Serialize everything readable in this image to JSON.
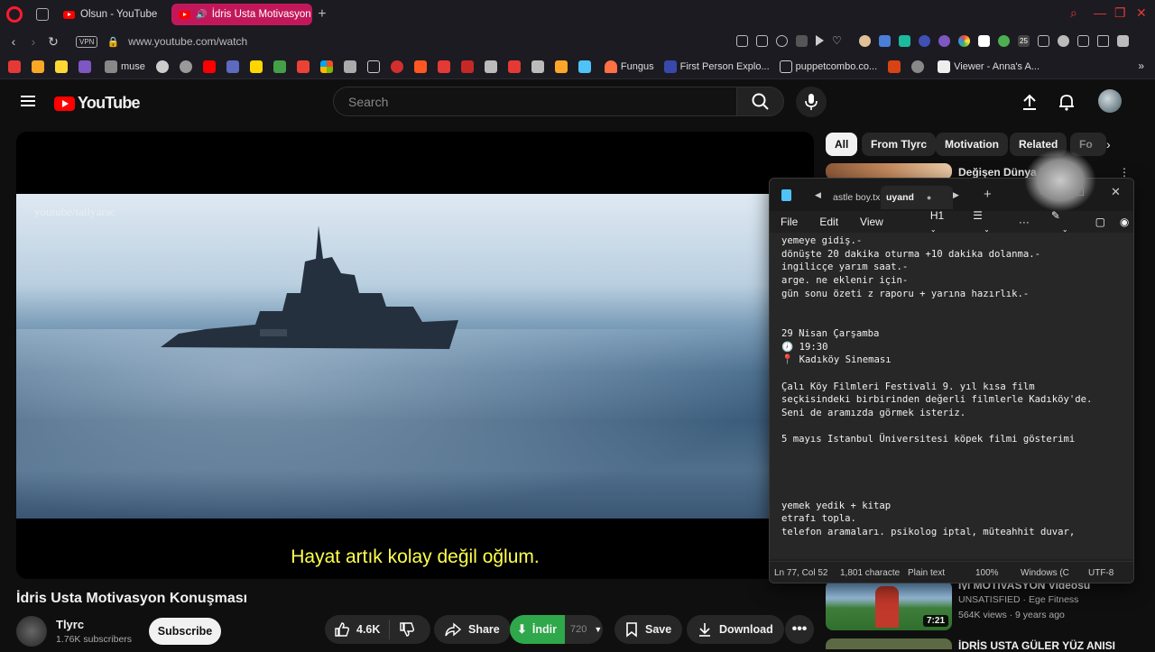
{
  "browser": {
    "tabs": [
      {
        "title": "Olsun - YouTube",
        "active": false
      },
      {
        "title": "İdris Usta Motivasyon K",
        "active": true
      }
    ],
    "url": "www.youtube.com/watch",
    "vpn_label": "VPN",
    "extension_badge": "25",
    "bookmarks": [
      "muse",
      "Fungus",
      "First Person Explo...",
      "puppetcombo.co...",
      "Viewer - Anna's A..."
    ]
  },
  "youtube": {
    "logo_text": "YouTube",
    "search_placeholder": "Search",
    "chips": [
      "All",
      "From Tlyrc",
      "Motivation",
      "Related",
      "Fo"
    ],
    "video": {
      "watermark": "youtube/tallyarac",
      "subtitle": "Hayat artık kolay değil oğlum.",
      "title": "İdris Usta Motivasyon Konuşması",
      "channel": "Tlyrc",
      "subscribers": "1.76K subscribers",
      "subscribe_label": "Subscribe",
      "likes": "4.6K",
      "share_label": "Share",
      "indir_label": "İndir",
      "quality": "720",
      "save_label": "Save",
      "download_label": "Download"
    },
    "recommendations": [
      {
        "title": "Değişen Dünya Koşulla",
        "channel": "",
        "meta": "",
        "duration": ""
      },
      {
        "title": "İyi MOTİVASYON Videosu",
        "channel": "UNSATISFIED · Ege Fitness",
        "meta": "564K views · 9 years ago",
        "duration": "7:21"
      },
      {
        "title": "İDRİS USTA GÜLER YÜZ ANISI",
        "channel": "",
        "meta": "",
        "duration": ""
      }
    ]
  },
  "notepad": {
    "tabs": [
      "astle boy.tx",
      "uyand"
    ],
    "menu": [
      "File",
      "Edit",
      "View"
    ],
    "heading_label": "H1",
    "lines": [
      "yemeye gidiş.-",
      "dönüşte 20 dakika oturma +10 dakika dolanma.-",
      "ingilicçe yarım saat.-",
      "arge. ne eklenir için-",
      "gün sonu özeti z raporu + yarına hazırlık.-",
      "",
      "",
      "29 Nisan Çarşamba",
      "🕖 19:30",
      "📍 Kadıköy Sineması",
      "",
      "Çalı Köy Filmleri Festivali 9. yıl kısa film",
      "seçkisindeki birbirinden değerli filmlerle Kadıköy'de.",
      "Seni de aramızda görmek isteriz.",
      "",
      "5 mayıs Istanbul Üniversitesi köpek filmi gösterimi",
      "",
      "",
      "",
      "",
      "yemek yedik + kitap",
      "etrafı topla.",
      "telefon aramaları. psikolog iptal, müteahhit duvar,"
    ],
    "status": {
      "position": "Ln 77, Col 52",
      "chars": "1,801 characte",
      "format": "Plain text",
      "zoom": "100%",
      "line_ending": "Windows (C",
      "encoding": "UTF-8"
    }
  },
  "colors": {
    "accent": "#c2185b",
    "yt_red": "#ff0000",
    "subtitle": "#ffff4d",
    "indir_green": "#2ea84a"
  }
}
